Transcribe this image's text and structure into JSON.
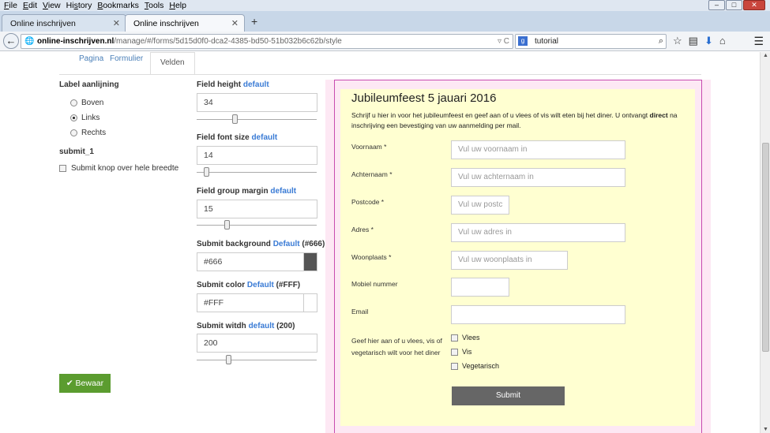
{
  "menubar": {
    "items": [
      {
        "pre": "",
        "u": "F",
        "post": "ile"
      },
      {
        "pre": "",
        "u": "E",
        "post": "dit"
      },
      {
        "pre": "",
        "u": "V",
        "post": "iew"
      },
      {
        "pre": "Hi",
        "u": "s",
        "post": "tory"
      },
      {
        "pre": "",
        "u": "B",
        "post": "ookmarks"
      },
      {
        "pre": "",
        "u": "T",
        "post": "ools"
      },
      {
        "pre": "",
        "u": "H",
        "post": "elp"
      }
    ]
  },
  "tabs": [
    {
      "title": "Online inschrijven"
    },
    {
      "title": "Online inschrijven"
    }
  ],
  "newtab": "+",
  "nav": {
    "url_domain": "online-inschrijven.nl",
    "url_path": "/manage/#/forms/5d15d0f0-dca2-4385-bd50-51b032b6c62b/style",
    "search_value": "tutorial"
  },
  "subtabs": [
    "Pagina",
    "Formulier",
    "Velden"
  ],
  "left": {
    "label_alignment_title": "Label aanlijning",
    "options": [
      "Boven",
      "Links",
      "Rechts"
    ],
    "selected": "Links",
    "submit_section": "submit_1",
    "full_width_label": "Submit knop over hele breedte",
    "save_button": "Bewaar"
  },
  "settings": {
    "field_height": {
      "label": "Field height",
      "link": "default",
      "value": "34",
      "level": 0.31
    },
    "field_font_size": {
      "label": "Field font size",
      "link": "default",
      "value": "14",
      "level": 0.06
    },
    "field_group_margin": {
      "label": "Field group margin",
      "link": "default",
      "value": "15",
      "level": 0.24
    },
    "submit_background": {
      "label": "Submit background",
      "link": "Default",
      "suffix": "(#666)",
      "value": "#666",
      "color": "#555555"
    },
    "submit_color": {
      "label": "Submit color",
      "link": "Default",
      "suffix": "(#FFF)",
      "value": "#FFF",
      "color": "#ffffff"
    },
    "submit_width": {
      "label": "Submit witdh",
      "link": "default",
      "suffix": "(200)",
      "value": "200",
      "level": 0.26
    }
  },
  "preview": {
    "title": "Jubileumfeest 5 jauari 2016",
    "desc_1": "Schrijf u hier in voor het jubileumfeest en geef aan of u vlees of vis wilt eten bij het diner. U ontvangt",
    "desc_bold": "direct",
    "desc_2": " na inschrijving een bevestiging van uw aanmelding per mail.",
    "fields": [
      {
        "label": "Voornaam *",
        "placeholder": "Vul uw voornaam in"
      },
      {
        "label": "Achternaam *",
        "placeholder": "Vul uw achternaam in"
      },
      {
        "label": "Postcode *",
        "placeholder": "Vul uw postc"
      },
      {
        "label": "Adres *",
        "placeholder": "Vul uw adres in"
      },
      {
        "label": "Woonplaats *",
        "placeholder": "Vul uw woonplaats in"
      },
      {
        "label": "Mobiel nummer",
        "placeholder": ""
      },
      {
        "label": "Email",
        "placeholder": ""
      }
    ],
    "choice_label_1": "Geef hier aan of u vlees, vis of",
    "choice_label_2": "vegetarisch wilt voor het diner",
    "choices": [
      "Vlees",
      "Vis",
      "Vegetarisch"
    ],
    "submit": "Submit"
  }
}
